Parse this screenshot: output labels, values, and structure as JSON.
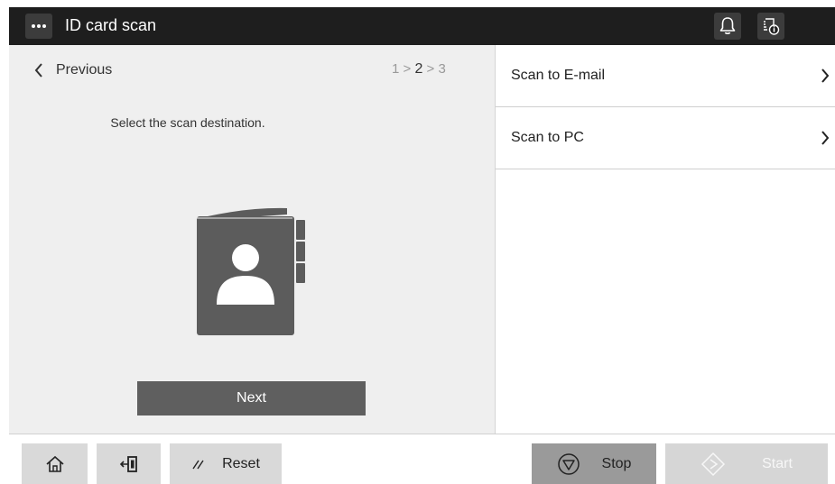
{
  "header": {
    "menu_icon": "ellipsis-icon",
    "title": "ID card scan",
    "notification_icon": "bell-icon",
    "job_info_icon": "job-status-icon"
  },
  "left_panel": {
    "previous_label": "Previous",
    "steps": {
      "first": "1 > ",
      "current": "2",
      "last": " > 3"
    },
    "instruction": "Select the scan destination.",
    "illustration_icon": "address-book-icon",
    "next_label": "Next"
  },
  "destinations": [
    {
      "label": "Scan to E-mail"
    },
    {
      "label": "Scan to PC"
    }
  ],
  "bottom_bar": {
    "home_icon": "home-icon",
    "logout_icon": "logout-icon",
    "reset_label": "Reset",
    "stop_label": "Stop",
    "start_label": "Start"
  },
  "colors": {
    "header_bg": "#1e1e1e",
    "panel_bg": "#efefef",
    "next_button": "#5f5f5f",
    "stop_button": "#9a9a9a",
    "start_button_disabled": "#d6d6d6"
  }
}
